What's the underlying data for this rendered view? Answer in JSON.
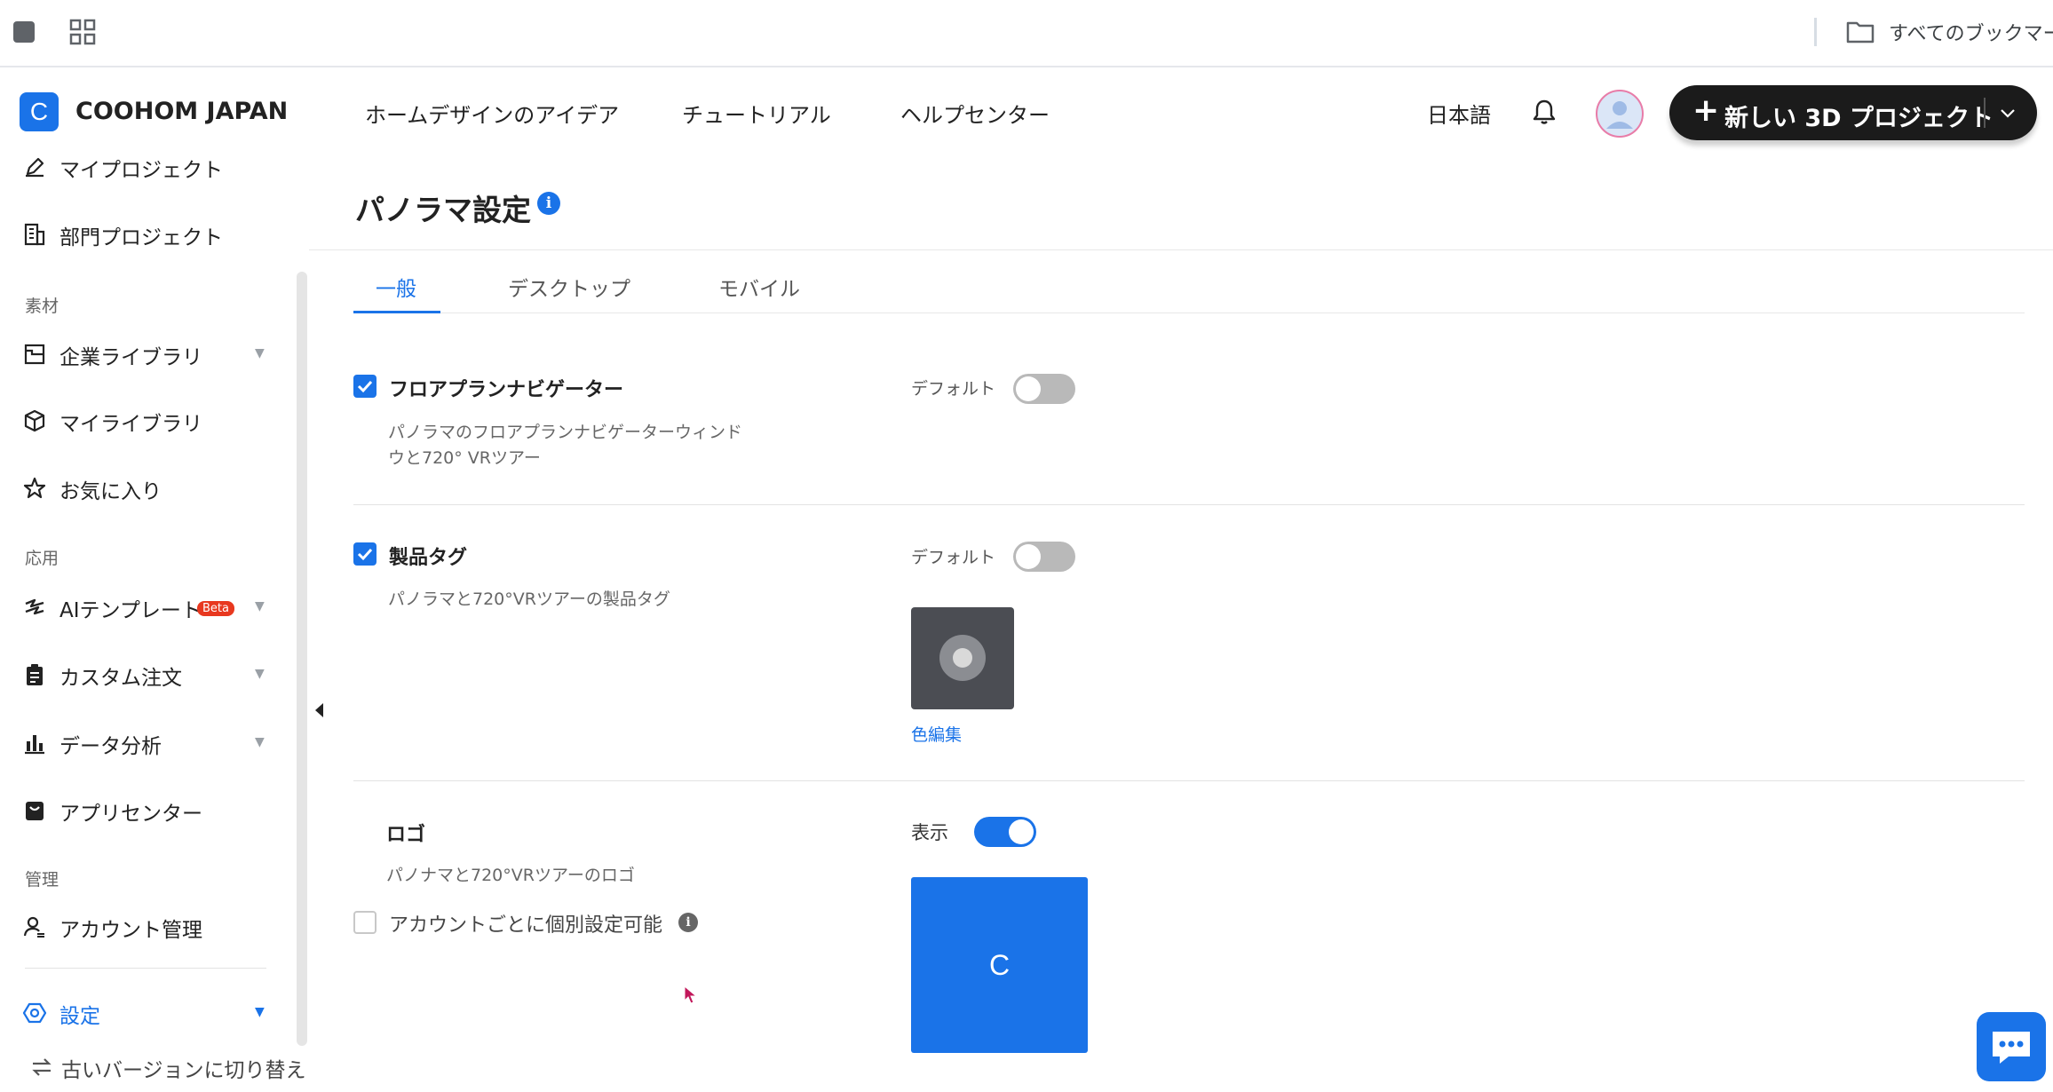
{
  "browser": {
    "bookmarks_label": "すべてのブックマーク"
  },
  "header": {
    "brand_letter": "C",
    "brand": "COOHOM JAPAN",
    "nav": [
      "ホームデザインのアイデア",
      "チュートリアル",
      "ヘルプセンター"
    ],
    "language": "日本語",
    "new_project_plus": "+",
    "new_project_label": "新しい 3D プロジェクト"
  },
  "sidebar": {
    "items_top": [
      {
        "label": "マイプロジェクト",
        "icon": "pen-icon"
      },
      {
        "label": "部門プロジェクト",
        "icon": "building-icon"
      }
    ],
    "section_material": "素材",
    "items_material": [
      {
        "label": "企業ライブラリ",
        "icon": "library-icon"
      },
      {
        "label": "マイライブラリ",
        "icon": "cube-icon"
      },
      {
        "label": "お気に入り",
        "icon": "star-icon"
      }
    ],
    "section_apps": "応用",
    "items_apps": [
      {
        "label": "AIテンプレート",
        "icon": "lightning-icon",
        "badge": "Beta"
      },
      {
        "label": "カスタム注文",
        "icon": "clipboard-icon"
      },
      {
        "label": "データ分析",
        "icon": "bar-chart-icon"
      },
      {
        "label": "アプリセンター",
        "icon": "shopping-bag-icon"
      }
    ],
    "section_admin": "管理",
    "items_admin": [
      {
        "label": "アカウント管理",
        "icon": "user-manage-icon"
      }
    ],
    "settings_label": "設定",
    "switch_version": "古いバージョンに切り替え",
    "accent_color": "#1a73e8"
  },
  "main": {
    "title": "パノラマ設定",
    "info_glyph": "i",
    "tabs": [
      "一般",
      "デスクトップ",
      "モバイル"
    ],
    "active_tab": 0,
    "rows": {
      "floorplan": {
        "title": "フロアプランナビゲーター",
        "desc_line1": "パノラマのフロアプランナビゲーターウィンド",
        "desc_line2": "ウと720° VRツアー",
        "toggle_label": "デフォルト",
        "checked": true,
        "toggle_on": false
      },
      "product_tag": {
        "title": "製品タグ",
        "desc": "パノラマと720°VRツアーの製品タグ",
        "toggle_label": "デフォルト",
        "checked": true,
        "toggle_on": false,
        "edit_color": "色編集"
      },
      "logo": {
        "title": "ロゴ",
        "desc": "パノナマと720°VRツアーのロゴ",
        "toggle_label": "表示",
        "toggle_on": true,
        "per_account_label": "アカウントごとに個別設定可能",
        "per_account_checked": false,
        "logo_letter": "C"
      }
    }
  }
}
